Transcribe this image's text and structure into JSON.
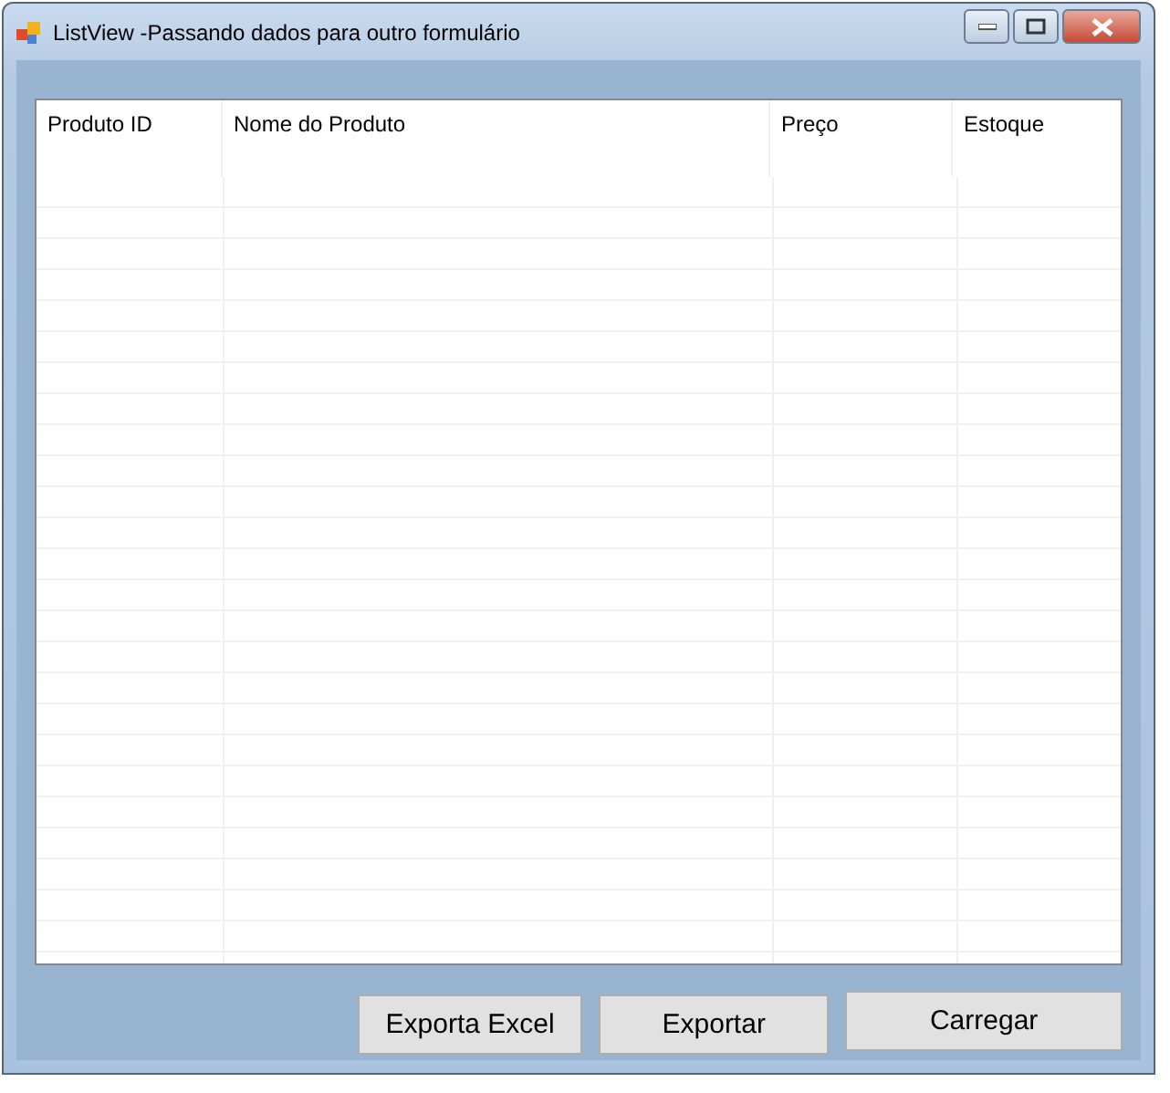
{
  "window": {
    "title": "ListView -Passando dados para outro formulário"
  },
  "list_view": {
    "columns": [
      {
        "label": "Produto ID"
      },
      {
        "label": "Nome do Produto"
      },
      {
        "label": "Preço"
      },
      {
        "label": "Estoque"
      }
    ]
  },
  "buttons": [
    {
      "label": "Exporta Excel"
    },
    {
      "label": "Exportar"
    },
    {
      "label": "Carregar"
    }
  ]
}
